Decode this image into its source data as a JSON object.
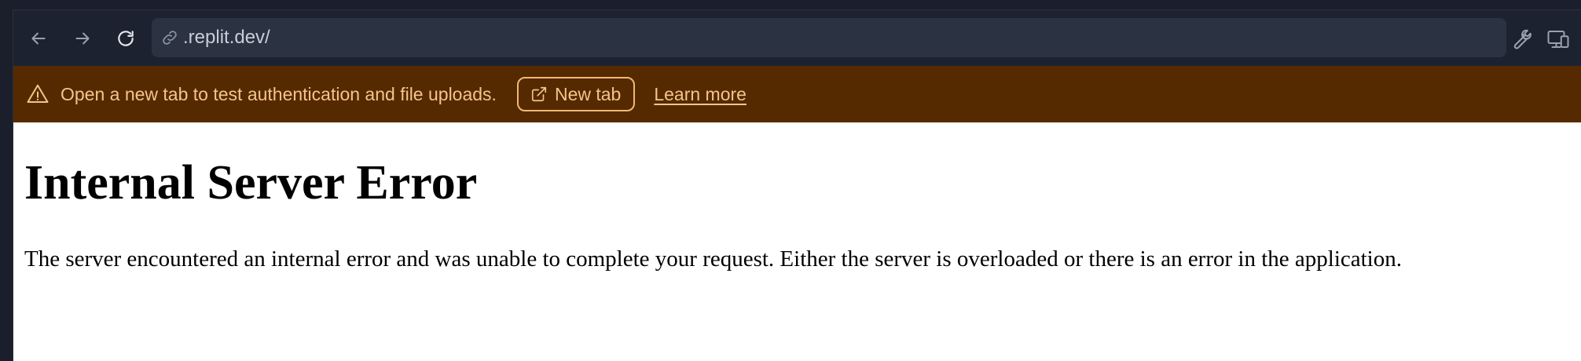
{
  "browser": {
    "url": ".replit.dev/",
    "icons": {
      "back": "arrow-left-icon",
      "forward": "arrow-right-icon",
      "reload": "reload-icon",
      "link": "link-icon",
      "devtools": "wrench-icon",
      "devices": "responsive-devices-icon"
    }
  },
  "banner": {
    "message": "Open a new tab to test authentication and file uploads.",
    "new_tab_label": "New tab",
    "learn_more_label": "Learn more",
    "icons": {
      "warning": "warning-triangle-icon",
      "external": "external-link-icon"
    },
    "colors": {
      "background": "#552a00",
      "text": "#f5c48a"
    }
  },
  "page": {
    "heading": "Internal Server Error",
    "body": "The server encountered an internal error and was unable to complete your request. Either the server is overloaded or there is an error in the application."
  }
}
